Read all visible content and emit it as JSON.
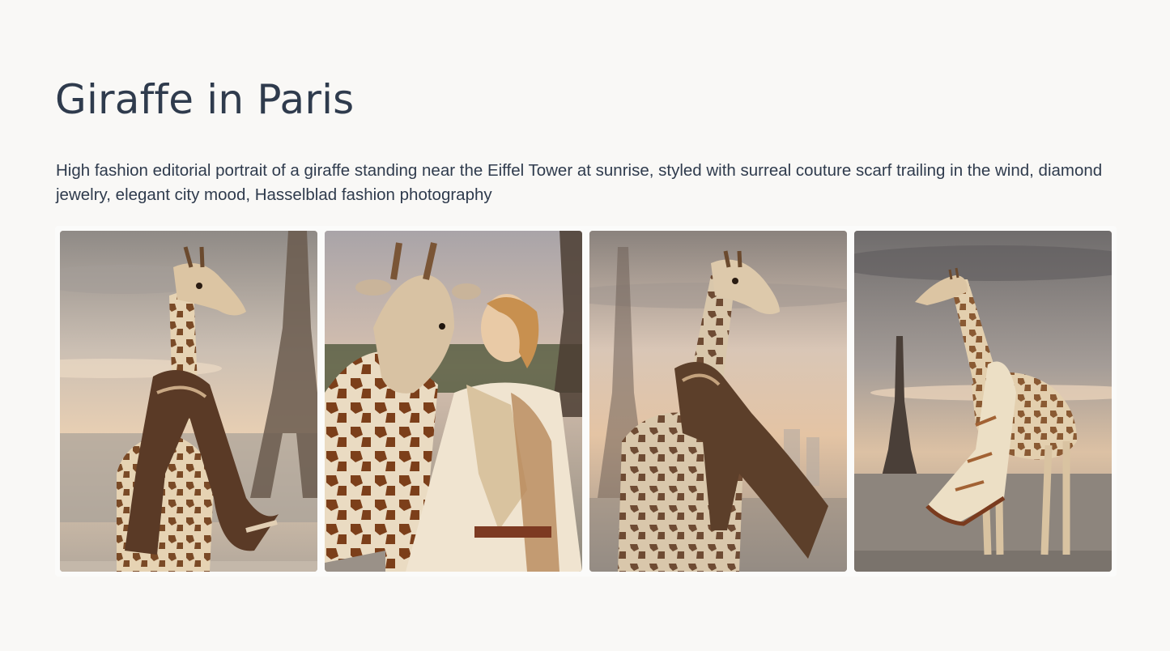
{
  "page": {
    "title": "Giraffe in Paris",
    "prompt": "High fashion editorial portrait of a giraffe standing near the Eiffel Tower at sunrise, styled with surreal couture scarf trailing in the wind, diamond jewelry, elegant city mood, Hasselblad fashion photography"
  },
  "gallery": {
    "images": [
      {
        "id": "image-1"
      },
      {
        "id": "image-2"
      },
      {
        "id": "image-3"
      },
      {
        "id": "image-4"
      }
    ]
  },
  "colors": {
    "background": "#f9f8f6",
    "text": "#2f3b4d"
  }
}
